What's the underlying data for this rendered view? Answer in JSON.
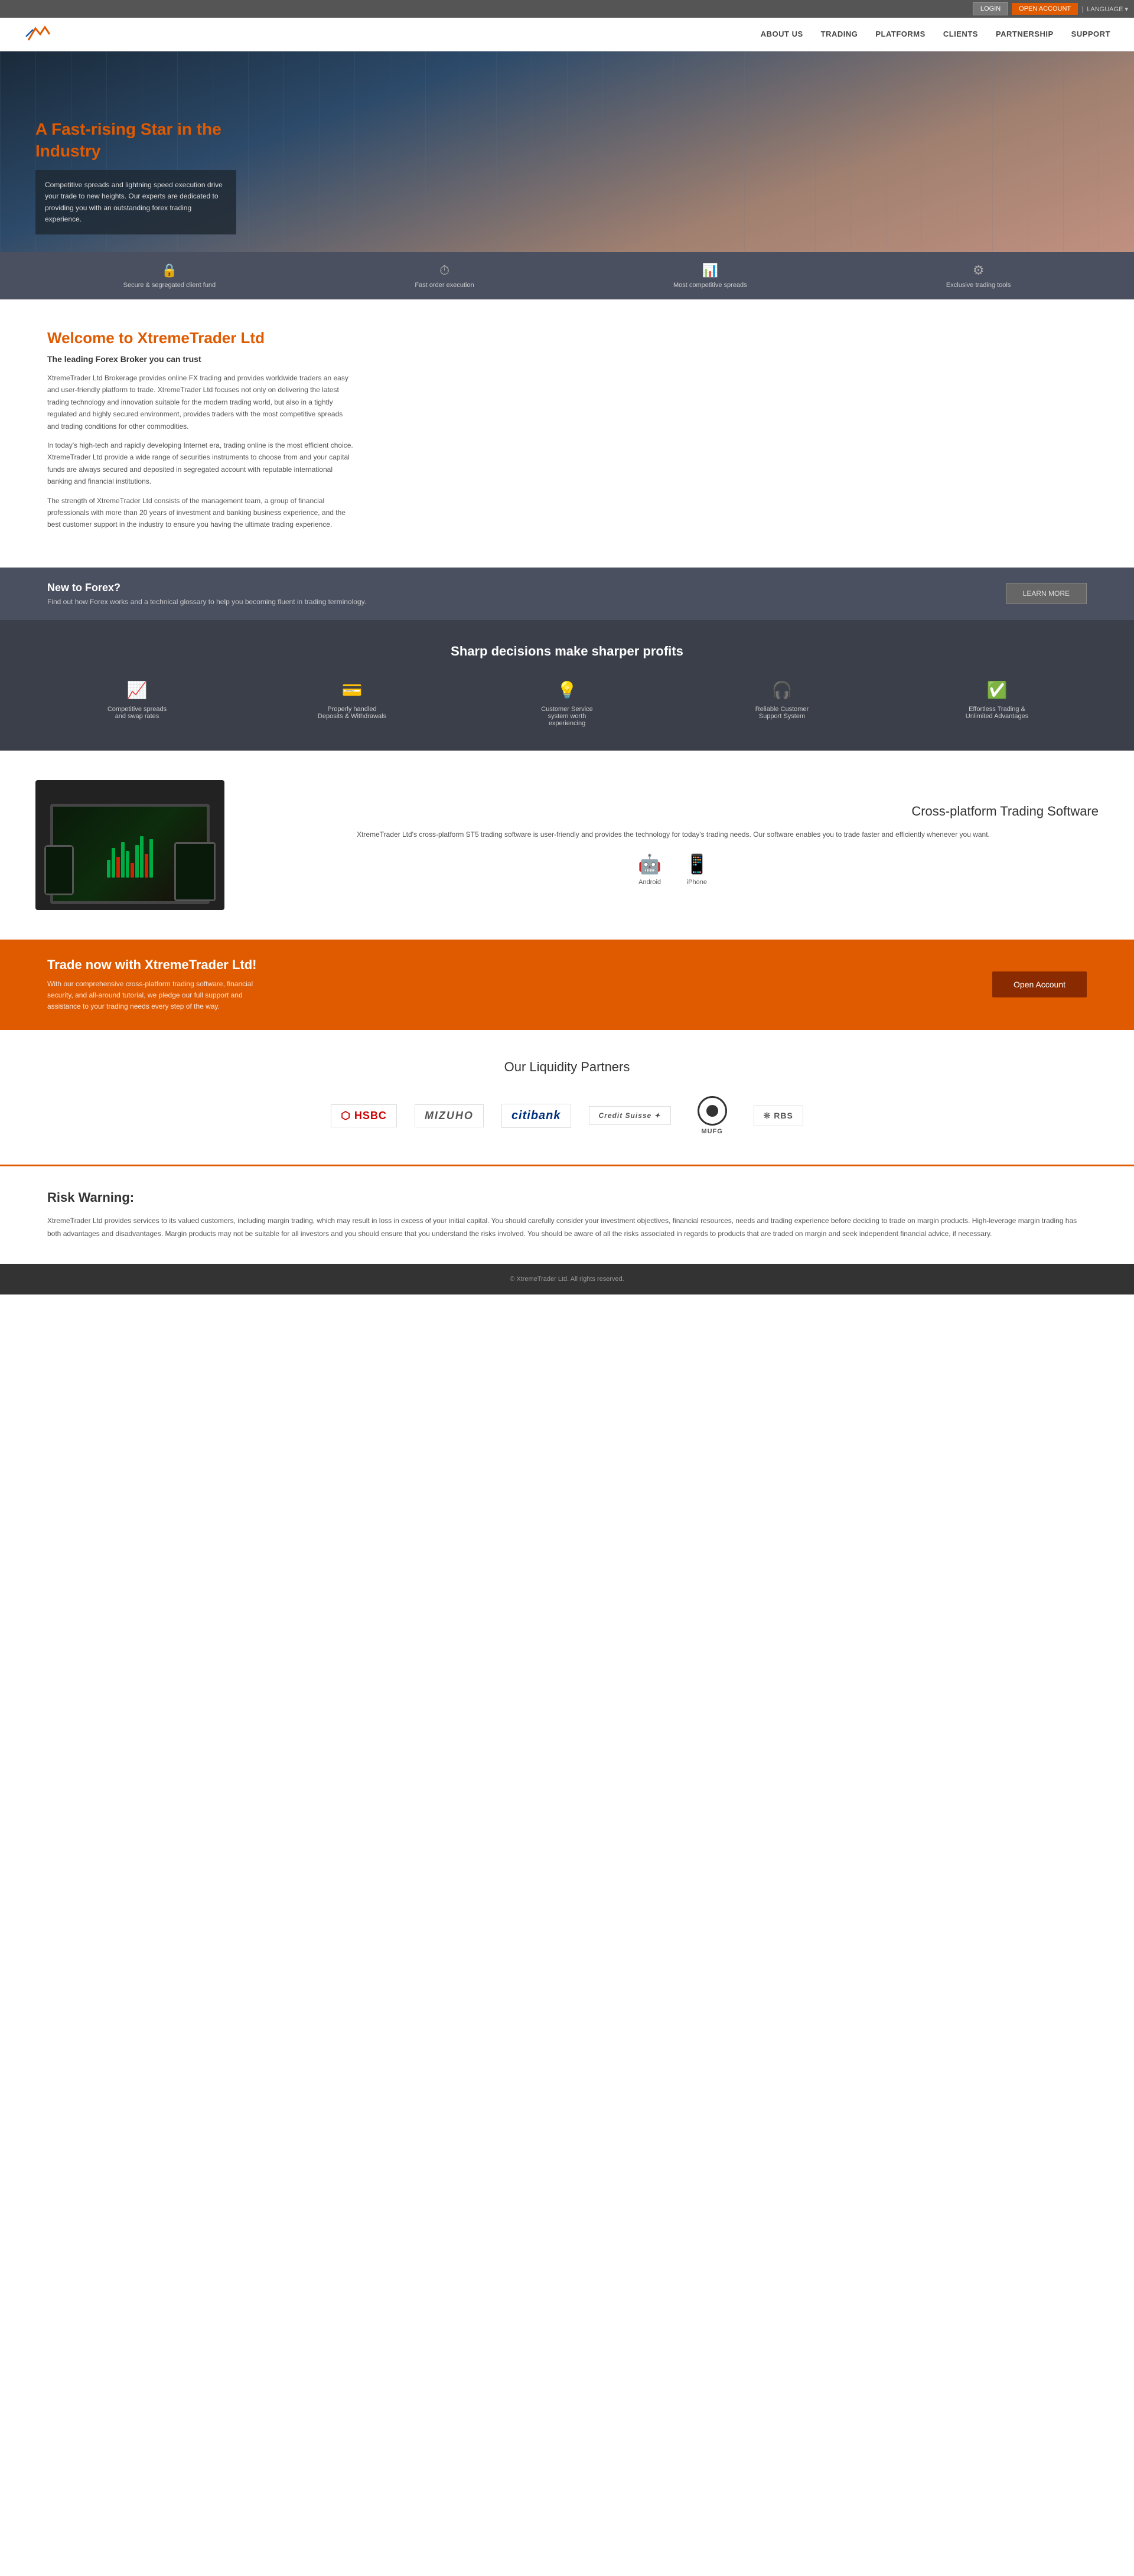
{
  "topbar": {
    "login_label": "LOGIN",
    "open_account_label": "OPEN ACCOUNT",
    "language_label": "LANGUAGE ▾"
  },
  "nav": {
    "logo_alt": "XtremeTrader Logo",
    "links": [
      {
        "label": "ABOUT US",
        "href": "#"
      },
      {
        "label": "TRADING",
        "href": "#"
      },
      {
        "label": "PLATFORMS",
        "href": "#"
      },
      {
        "label": "CLIENTS",
        "href": "#"
      },
      {
        "label": "PARTNERSHIP",
        "href": "#"
      },
      {
        "label": "SUPPORT",
        "href": "#"
      }
    ]
  },
  "hero": {
    "title": "A Fast-rising Star in the Industry",
    "description": "Competitive spreads and lightning speed execution drive your trade to new heights. Our experts are dedicated to providing you with an outstanding forex trading experience."
  },
  "features_bar": {
    "items": [
      {
        "icon": "🔒",
        "label": "Secure & segregated client fund"
      },
      {
        "icon": "⏱",
        "label": "Fast order execution"
      },
      {
        "icon": "📊",
        "label": "Most competitive spreads"
      },
      {
        "icon": "⚙",
        "label": "Exclusive trading tools"
      }
    ]
  },
  "welcome": {
    "title_plain": "Welcome to ",
    "title_colored": "XtremeTrader Ltd",
    "subtitle": "The leading Forex Broker you can trust",
    "paragraphs": [
      "XtremeTrader Ltd Brokerage provides online FX trading and provides worldwide traders an easy and user-friendly platform to trade. XtremeTrader Ltd focuses not only on delivering the latest trading technology and innovation suitable for the modern trading world, but also in a tightly regulated and highly secured environment, provides traders with the most competitive spreads and trading conditions for other commodities.",
      "In today's high-tech and rapidly developing Internet era, trading online is the most efficient choice. XtremeTrader Ltd provide a wide range of securities instruments to choose from and your capital funds are always secured and deposited in segregated account with reputable international banking and financial institutions.",
      "The strength of XtremeTrader Ltd consists of the management team, a group of financial professionals with more than 20 years of investment and banking business experience, and the best customer support in the industry to ensure you having the ultimate trading experience."
    ]
  },
  "forex_banner": {
    "title": "New to Forex?",
    "description": "Find out how Forex works and a technical glossary to help you becoming fluent in trading terminology.",
    "button_label": "LEARN MORE"
  },
  "sharp_section": {
    "title": "Sharp decisions make sharper profits",
    "items": [
      {
        "icon": "📈",
        "label": "Competitive spreads and swap rates"
      },
      {
        "icon": "💳",
        "label": "Properly handled Deposits & Withdrawals"
      },
      {
        "icon": "💡",
        "label": "Customer Service system worth experiencing"
      },
      {
        "icon": "🎧",
        "label": "Reliable Customer Support System"
      },
      {
        "icon": "✅",
        "label": "Effortless Trading & Unlimited Advantages"
      }
    ]
  },
  "trading_software": {
    "title": "Cross-platform Trading Software",
    "description": "XtremeTrader Ltd's cross-platform ST5 trading software is user-friendly and provides the technology for today's trading needs. Our software enables you to trade faster and efficiently whenever you want.",
    "platforms": [
      {
        "icon": "🤖",
        "label": "Android"
      },
      {
        "icon": "📱",
        "label": "iPhone"
      }
    ]
  },
  "cta": {
    "title": "Trade now with XtremeTrader Ltd!",
    "description": "With our comprehensive cross-platform trading software, financial security, and all-around tutorial, we pledge our full support and assistance to your trading needs every step of the way.",
    "button_label": "Open Account"
  },
  "partners": {
    "title": "Our Liquidity Partners",
    "logos": [
      {
        "label": "HSBC",
        "class": "hsbc"
      },
      {
        "label": "MIZUHO",
        "class": ""
      },
      {
        "label": "citibank",
        "class": "citi"
      },
      {
        "label": "Credit Suisse",
        "class": ""
      },
      {
        "label": "MUFG",
        "class": "mufg"
      },
      {
        "label": "❊RBS",
        "class": ""
      }
    ]
  },
  "risk": {
    "title": "Risk Warning:",
    "text": "XtremeTrader Ltd provides services to its valued customers, including margin trading, which may result in loss in excess of your initial capital. You should carefully consider your investment objectives, financial resources, needs and trading experience before deciding to trade on margin products. High-leverage margin trading has both advantages and disadvantages. Margin products may not be suitable for all investors and you should ensure that you understand the risks involved. You should be aware of all the risks associated in regards to products that are traded on margin and seek independent financial advice, if necessary."
  },
  "footer": {
    "text": "© XtremeTrader Ltd. All rights reserved."
  }
}
